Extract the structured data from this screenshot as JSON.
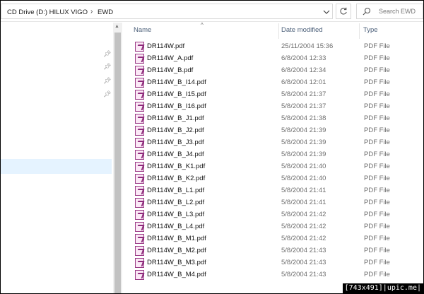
{
  "address_bar": {
    "breadcrumb": [
      "CD Drive (D:) HILUX VIGO",
      "EWD"
    ],
    "search_placeholder": "Search EWD"
  },
  "columns": {
    "name": "Name",
    "date": "Date modified",
    "type": "Type"
  },
  "files": [
    {
      "name": "DR114W.pdf",
      "date": "25/11/2004 15:36",
      "type": "PDF File"
    },
    {
      "name": "DR114W_A.pdf",
      "date": "6/8/2004 12:33",
      "type": "PDF File"
    },
    {
      "name": "DR114W_B.pdf",
      "date": "6/8/2004 12:34",
      "type": "PDF File"
    },
    {
      "name": "DR114W_B_I14.pdf",
      "date": "6/8/2004 12:01",
      "type": "PDF File"
    },
    {
      "name": "DR114W_B_I15.pdf",
      "date": "5/8/2004 21:37",
      "type": "PDF File"
    },
    {
      "name": "DR114W_B_I16.pdf",
      "date": "5/8/2004 21:37",
      "type": "PDF File"
    },
    {
      "name": "DR114W_B_J1.pdf",
      "date": "5/8/2004 21:38",
      "type": "PDF File"
    },
    {
      "name": "DR114W_B_J2.pdf",
      "date": "5/8/2004 21:39",
      "type": "PDF File"
    },
    {
      "name": "DR114W_B_J3.pdf",
      "date": "5/8/2004 21:39",
      "type": "PDF File"
    },
    {
      "name": "DR114W_B_J4.pdf",
      "date": "5/8/2004 21:39",
      "type": "PDF File"
    },
    {
      "name": "DR114W_B_K1.pdf",
      "date": "5/8/2004 21:40",
      "type": "PDF File"
    },
    {
      "name": "DR114W_B_K2.pdf",
      "date": "5/8/2004 21:40",
      "type": "PDF File"
    },
    {
      "name": "DR114W_B_L1.pdf",
      "date": "5/8/2004 21:41",
      "type": "PDF File"
    },
    {
      "name": "DR114W_B_L2.pdf",
      "date": "5/8/2004 21:41",
      "type": "PDF File"
    },
    {
      "name": "DR114W_B_L3.pdf",
      "date": "5/8/2004 21:42",
      "type": "PDF File"
    },
    {
      "name": "DR114W_B_L4.pdf",
      "date": "5/8/2004 21:42",
      "type": "PDF File"
    },
    {
      "name": "DR114W_B_M1.pdf",
      "date": "5/8/2004 21:42",
      "type": "PDF File"
    },
    {
      "name": "DR114W_B_M2.pdf",
      "date": "5/8/2004 21:43",
      "type": "PDF File"
    },
    {
      "name": "DR114W_B_M3.pdf",
      "date": "5/8/2004 21:43",
      "type": "PDF File"
    },
    {
      "name": "DR114W_B_M4.pdf",
      "date": "5/8/2004 21:43",
      "type": "PDF File"
    }
  ],
  "watermark": "[743x491]|upic.me|",
  "icons": {
    "file": "pdf-file-icon",
    "pin": "pin-icon",
    "search": "search-icon",
    "refresh": "refresh-icon",
    "chevron": "chevron-right-icon"
  },
  "colors": {
    "selection": "#e5f3ff",
    "header_text": "#4c607a",
    "pdf_icon": "#9a3a86"
  }
}
